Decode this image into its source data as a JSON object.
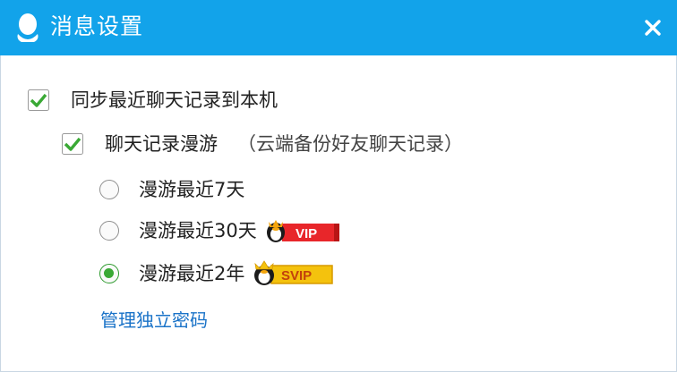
{
  "window": {
    "title": "消息设置",
    "close_glyph": "✕"
  },
  "options": {
    "sync": {
      "label": "同步最近聊天记录到本机",
      "checked": true
    },
    "roam": {
      "label": "聊天记录漫游",
      "hint": "（云端备份好友聊天记录）",
      "checked": true
    }
  },
  "radio_options": [
    {
      "label": "漫游最近7天",
      "selected": false,
      "badge": ""
    },
    {
      "label": "漫游最近30天",
      "selected": false,
      "badge": "VIP"
    },
    {
      "label": "漫游最近2年",
      "selected": true,
      "badge": "SVIP"
    }
  ],
  "link": {
    "label": "管理独立密码"
  },
  "colors": {
    "titlebar": "#12a3ea",
    "check_green": "#3aa935",
    "link": "#1a73c8",
    "vip_red": "#e8262a",
    "svip_gold": "#f4c20d"
  },
  "icons": {
    "title": "qq-penguin-icon",
    "close": "close-icon",
    "check": "checkmark-icon",
    "vip": "vip-badge-icon",
    "svip": "svip-badge-icon"
  }
}
